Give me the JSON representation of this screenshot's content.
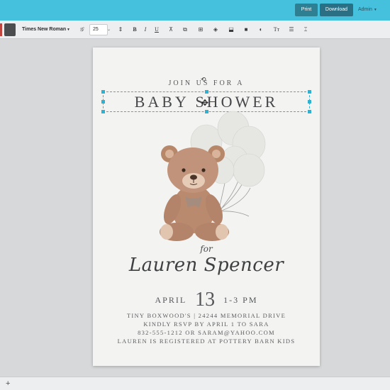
{
  "header": {
    "print_label": "Print",
    "download_label": "Download",
    "admin_label": "Admin"
  },
  "toolbar": {
    "font_family": "Times New Roman",
    "font_size": "25",
    "icons": [
      "text-style-icon",
      "line-height-icon",
      "bold-icon",
      "italic-icon",
      "underline-icon",
      "transform-icon",
      "duplicate-icon",
      "layers-icon",
      "lock-icon",
      "color-icon",
      "text-case-icon",
      "line-spacing-icon",
      "reset-icon"
    ]
  },
  "invitation": {
    "join_us": "JOIN US FOR A",
    "title": "BABY SHOWER",
    "for": "for",
    "name": "Lauren Spencer",
    "month": "APRIL",
    "day": "13",
    "time": "1-3 PM",
    "line1": "TINY BOXWOOD'S | 24244 MEMORIAL DRIVE",
    "line2": "KINDLY RSVP BY APRIL 1 TO SARA",
    "line3": "832-555-1212 OR SARAM@YAHOO.COM",
    "line4": "LAUREN IS REGISTERED AT POTTERY BARN KIDS"
  },
  "bottom": {
    "add_label": "+"
  },
  "colors": {
    "header_bg": "#45c1de",
    "selection": "#2bb3d5"
  }
}
